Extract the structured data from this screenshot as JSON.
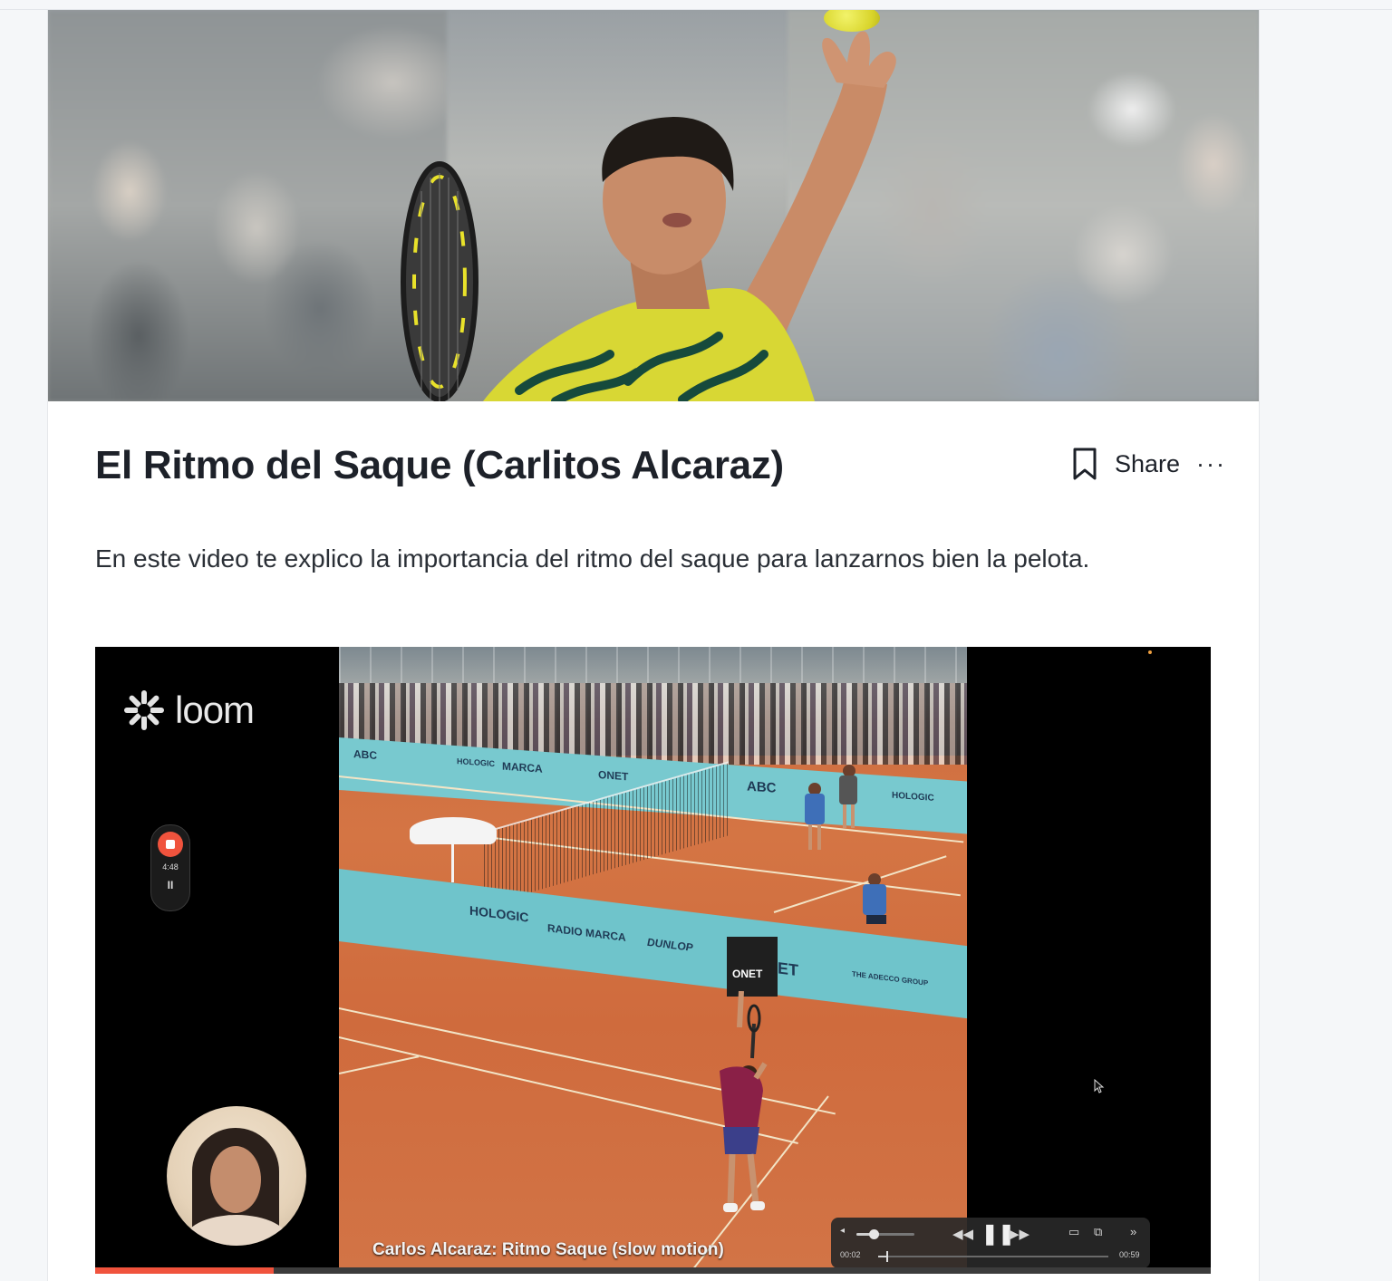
{
  "post": {
    "title": "El Ritmo del Saque (Carlitos Alcaraz)",
    "description": "En este video te explico la importancia del ritmo del saque para lanzarnos bien la pelota.",
    "actions": {
      "bookmark_icon": "bookmark-icon",
      "share_label": "Share",
      "more_label": "···",
      "more_icon": "more-horizontal-icon"
    }
  },
  "hero": {
    "image": "hero-photo-tennis-player-serving"
  },
  "video": {
    "brand": "loom",
    "recording": {
      "time": "4:48",
      "stop_icon": "stop-record-icon",
      "pause_icon": "pause-icon",
      "pause_glyph": "II"
    },
    "court_ads": [
      "ABC",
      "MARCA",
      "HOLOGIC",
      "ONET",
      "RADIO MARCA",
      "DUNLOP",
      "ABC",
      "HOLOGIC",
      "THE ADECCO GROUP",
      "ET"
    ],
    "caption": "Carlos Alcaraz: Ritmo Saque (slow motion)",
    "player_controls": {
      "volume_level": 0.3,
      "current_time": "00:02",
      "duration": "00:59",
      "seek_fraction": 0.034,
      "icons": [
        "volume-icon",
        "rewind-icon",
        "pause-icon",
        "fast-forward-icon",
        "airplay-icon",
        "picture-in-picture-icon",
        "expand-icon"
      ]
    },
    "loom_progress": 0.16,
    "colors": {
      "record_red": "#f0533d",
      "clay": "#cf6b3d",
      "court_wall": "#6fc4cb"
    }
  }
}
